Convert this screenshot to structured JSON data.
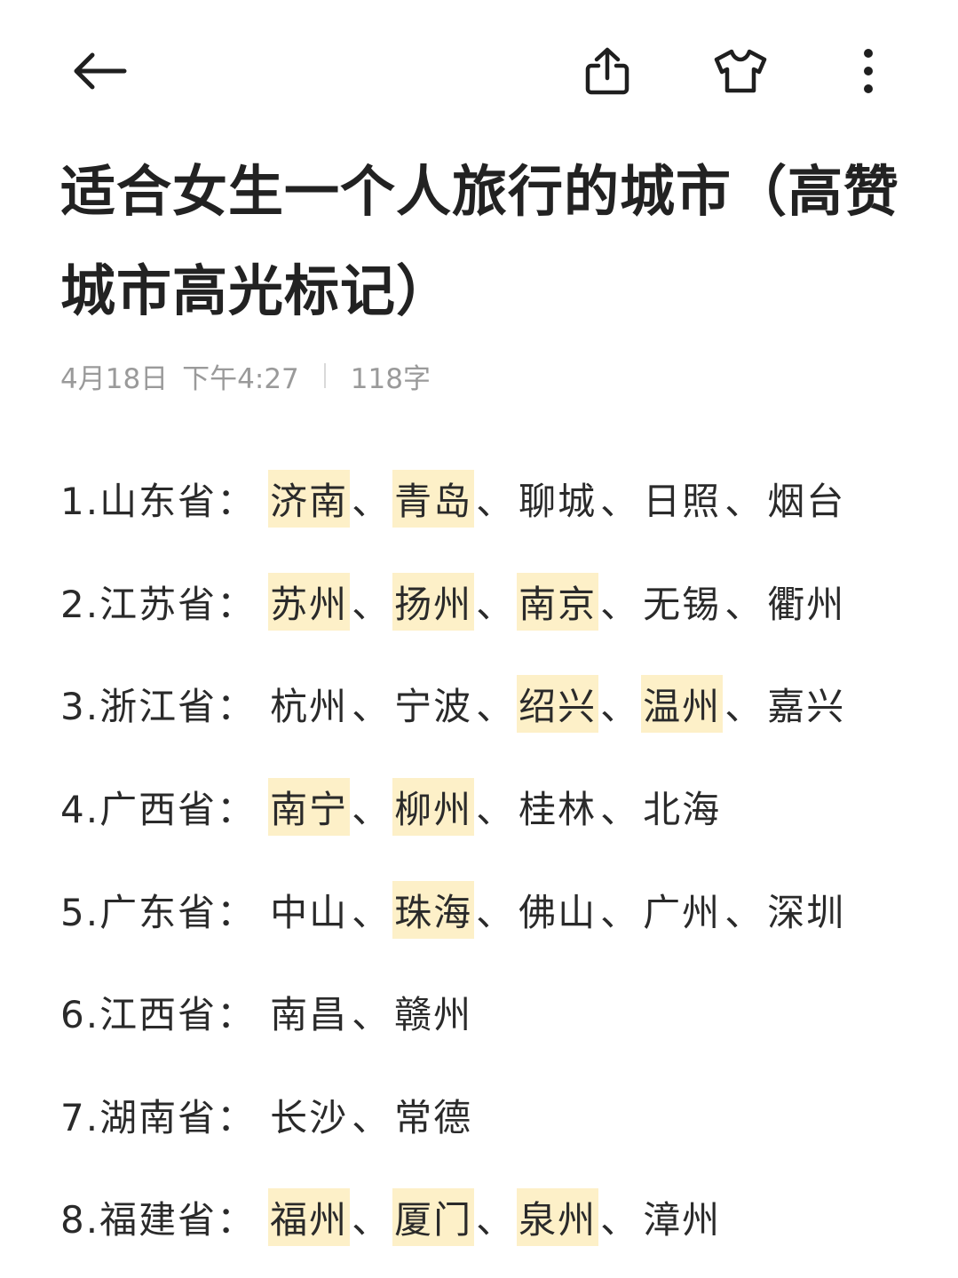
{
  "header": {
    "back_icon": "arrow-left-icon",
    "share_icon": "share-icon",
    "theme_icon": "tshirt-icon",
    "more_icon": "more-vertical-icon"
  },
  "note": {
    "title": "适合女生一个人旅行的城市（高赞城市高光标记）",
    "date": "4月18日",
    "time": "下午4:27",
    "word_count": "118字"
  },
  "colors": {
    "highlight": "#fdf0c8",
    "meta_text": "#9a9a9a"
  },
  "separator": "、",
  "provinces": [
    {
      "label": "1.山东省：",
      "cities": [
        {
          "name": "济南",
          "highlighted": true
        },
        {
          "name": "青岛",
          "highlighted": true
        },
        {
          "name": "聊城",
          "highlighted": false
        },
        {
          "name": "日照",
          "highlighted": false
        },
        {
          "name": "烟台",
          "highlighted": false
        }
      ]
    },
    {
      "label": "2.江苏省：",
      "cities": [
        {
          "name": "苏州",
          "highlighted": true
        },
        {
          "name": "扬州",
          "highlighted": true
        },
        {
          "name": "南京",
          "highlighted": true
        },
        {
          "name": "无锡",
          "highlighted": false
        },
        {
          "name": "衢州",
          "highlighted": false
        }
      ]
    },
    {
      "label": "3.浙江省：",
      "cities": [
        {
          "name": "杭州",
          "highlighted": false
        },
        {
          "name": "宁波",
          "highlighted": false
        },
        {
          "name": "绍兴",
          "highlighted": true
        },
        {
          "name": "温州",
          "highlighted": true
        },
        {
          "name": "嘉兴",
          "highlighted": false
        }
      ]
    },
    {
      "label": "4.广西省：",
      "cities": [
        {
          "name": "南宁",
          "highlighted": true
        },
        {
          "name": "柳州",
          "highlighted": true
        },
        {
          "name": "桂林",
          "highlighted": false
        },
        {
          "name": "北海",
          "highlighted": false
        }
      ]
    },
    {
      "label": "5.广东省：",
      "cities": [
        {
          "name": "中山",
          "highlighted": false
        },
        {
          "name": "珠海",
          "highlighted": true
        },
        {
          "name": "佛山",
          "highlighted": false
        },
        {
          "name": "广州",
          "highlighted": false
        },
        {
          "name": "深圳",
          "highlighted": false
        }
      ]
    },
    {
      "label": "6.江西省：",
      "cities": [
        {
          "name": "南昌",
          "highlighted": false
        },
        {
          "name": "赣州",
          "highlighted": false
        }
      ]
    },
    {
      "label": "7.湖南省：",
      "cities": [
        {
          "name": "长沙",
          "highlighted": false
        },
        {
          "name": "常德",
          "highlighted": false
        }
      ]
    },
    {
      "label": "8.福建省：",
      "cities": [
        {
          "name": "福州",
          "highlighted": true
        },
        {
          "name": "厦门",
          "highlighted": true
        },
        {
          "name": "泉州",
          "highlighted": true
        },
        {
          "name": "漳州",
          "highlighted": false
        }
      ]
    }
  ]
}
